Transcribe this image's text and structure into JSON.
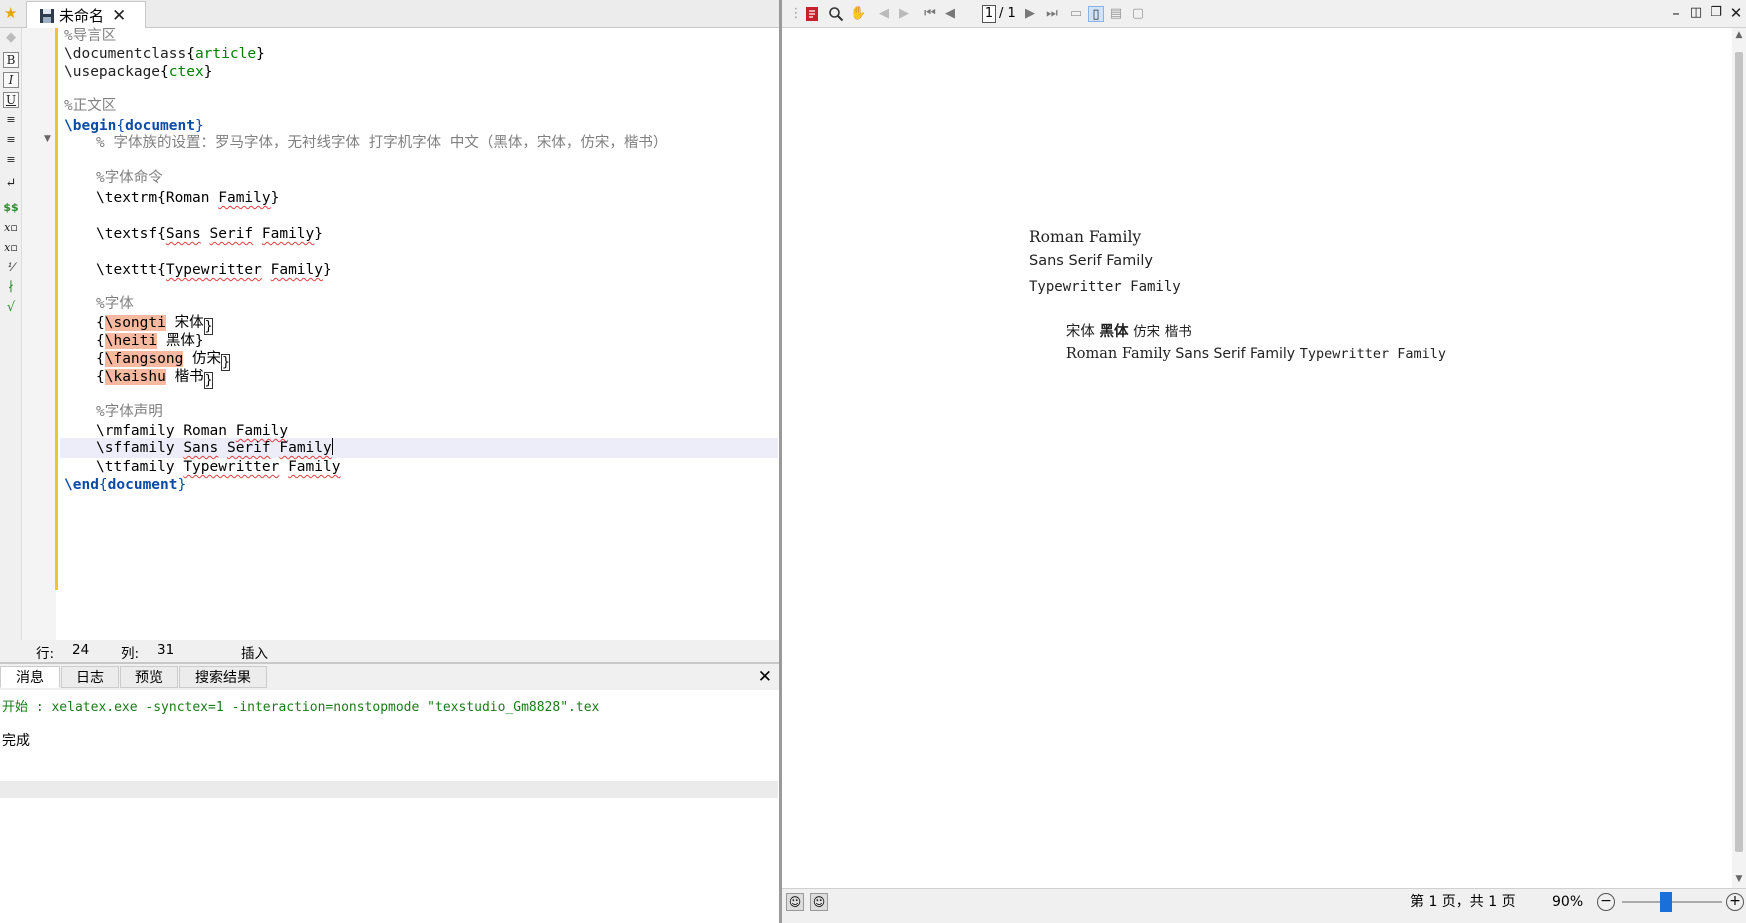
{
  "editor_tab": {
    "title": "未命名"
  },
  "side_toolbar": {
    "bold": "B",
    "italic": "I",
    "underline": "U",
    "math": "$$"
  },
  "editor": {
    "lines": [
      "%导言区",
      "\\documentclass{article}",
      "\\usepackage{ctex}",
      "%正文区",
      "\\begin{document}",
      "% 字体族的设置：罗马字体，无衬线字体 打字机字体 中文（黑体，宋体，仿宋，楷书）",
      "%字体命令",
      "\\textrm{Roman Family}",
      "\\textsf{Sans Serif Family}",
      "\\texttt{Typewritter Family}",
      "%字体",
      "{\\songti 宋体}",
      "{\\heiti 黑体}",
      "{\\fangsong 仿宋}",
      "{\\kaishu 楷书}",
      "%字体声明",
      "\\rmfamily Roman Family",
      "\\sffamily Sans Serif Family",
      "\\ttfamily Typewritter Family",
      "\\end{document}"
    ],
    "tokens": {
      "l1_cmd": "\\documentclass",
      "l1_arg": "article",
      "l2_cmd": "\\usepackage",
      "l2_arg": "ctex",
      "begin_cmd": "\\begin",
      "begin_arg": "document",
      "c_font": "% 字体族的设置：罗马字体，无衬线字体 打字机字体 中文（黑体，宋体，仿宋，楷书）",
      "c_cmds": "%字体命令",
      "textrm_cmd": "\\textrm",
      "textrm_a": "Roman",
      "textrm_b": "Family",
      "textsf_cmd": "\\textsf",
      "textsf_a": "Sans",
      "textsf_b": "Serif",
      "textsf_c": "Family",
      "texttt_cmd": "\\texttt",
      "texttt_a": "Typewritter",
      "texttt_b": "Family",
      "c_ziti": "%字体",
      "songti_cmd": "\\songti",
      "songti_txt": "宋体",
      "heiti_cmd": "\\heiti",
      "heiti_txt": "黑体",
      "fangsong_cmd": "\\fangsong",
      "fangsong_txt": "仿宋",
      "kaishu_cmd": "\\kaishu",
      "kaishu_txt": "楷书",
      "c_decl": "%字体声明",
      "rm_cmd": "\\rmfamily",
      "rm_a": "Roman",
      "rm_b": "Family",
      "sf_cmd": "\\sffamily",
      "sf_a": "Sans",
      "sf_b": "Serif",
      "sf_c": "Family",
      "tt_cmd": "\\ttfamily",
      "tt_a": "Typewritter",
      "tt_b": "Family",
      "end_cmd": "\\end",
      "end_arg": "document",
      "c_preamble": "%导言区",
      "c_body": "%正文区"
    }
  },
  "status": {
    "line_label": "行:",
    "line_value": "24",
    "col_label": "列:",
    "col_value": "31",
    "mode": "插入"
  },
  "messages": {
    "tabs": [
      "消息",
      "日志",
      "预览",
      "搜索结果"
    ],
    "line1": "开始 : xelatex.exe -synctex=1 -interaction=nonstopmode \"texstudio_Gm8828\".tex",
    "line2": "完成"
  },
  "pdf": {
    "page_current": "1",
    "page_total": "/ 1",
    "content": {
      "roman": "Roman Family",
      "sans": "Sans Serif Family",
      "tt": "Typewritter Family",
      "songti": "宋体",
      "heiti": "黑体",
      "fangsong": "仿宋",
      "kaishu": "楷书",
      "mixed_rm": "Roman Family",
      "mixed_sf": "Sans Serif Family",
      "mixed_tt": "Typewritter Family"
    },
    "page_info": "第 1 页，共 1 页",
    "zoom": "90%"
  }
}
